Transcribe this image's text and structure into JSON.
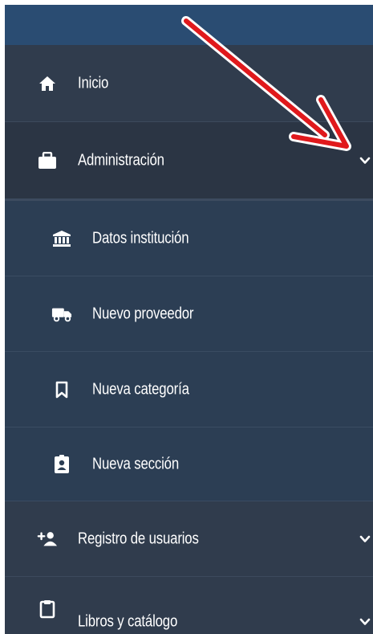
{
  "menu": {
    "inicio": {
      "label": "Inicio",
      "icon": "home-icon"
    },
    "administracion": {
      "label": "Administración",
      "icon": "briefcase-icon",
      "expanded": true,
      "children": [
        {
          "label": "Datos institución",
          "icon": "institution-icon"
        },
        {
          "label": "Nuevo proveedor",
          "icon": "truck-icon"
        },
        {
          "label": "Nueva categoría",
          "icon": "bookmark-icon"
        },
        {
          "label": "Nueva sección",
          "icon": "id-badge-icon"
        }
      ]
    },
    "registro": {
      "label": "Registro de usuarios",
      "icon": "user-plus-icon"
    },
    "libros": {
      "label": "Libros y catálogo",
      "icon": "clipboard-icon"
    }
  },
  "colors": {
    "sidebar_bg": "#2e3a4a",
    "submenu_bg": "#2c3e54",
    "annotation_arrow": "#e0191c"
  }
}
